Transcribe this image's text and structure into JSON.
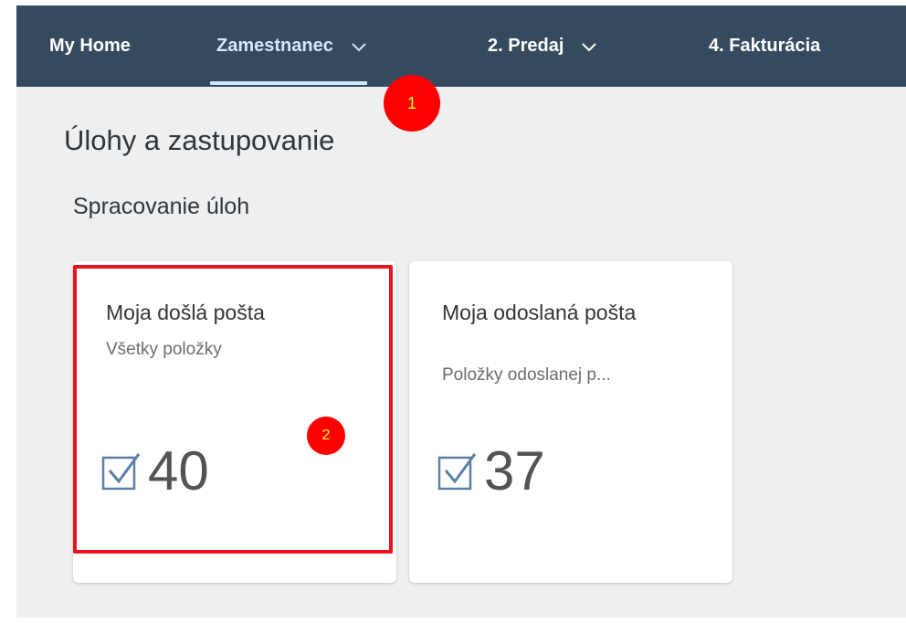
{
  "nav": {
    "items": [
      {
        "label": "My Home",
        "has_dropdown": false,
        "active": false
      },
      {
        "label": "Zamestnanec",
        "has_dropdown": true,
        "active": true
      },
      {
        "label": "2. Predaj",
        "has_dropdown": true,
        "active": false
      },
      {
        "label": "4. Fakturácia",
        "has_dropdown": false,
        "active": false
      }
    ],
    "dropdown_icon": "chevron-down-icon",
    "background": "#354a5f",
    "active_color": "#d1e8ff"
  },
  "page": {
    "title": "Úlohy a zastupovanie",
    "section_title": "Spracovanie úloh"
  },
  "tiles": [
    {
      "title": "Moja došlá pošta",
      "subtitle": "Všetky položky",
      "value": "40",
      "icon": "task-check-icon"
    },
    {
      "title": "Moja odoslaná pošta",
      "subtitle": "Položky odoslanej p...",
      "value": "37",
      "icon": "task-check-icon"
    }
  ],
  "annotations": {
    "marker_1": "1",
    "marker_2": "2",
    "marker_color": "#ff0000",
    "highlight_color": "#e8141c"
  }
}
